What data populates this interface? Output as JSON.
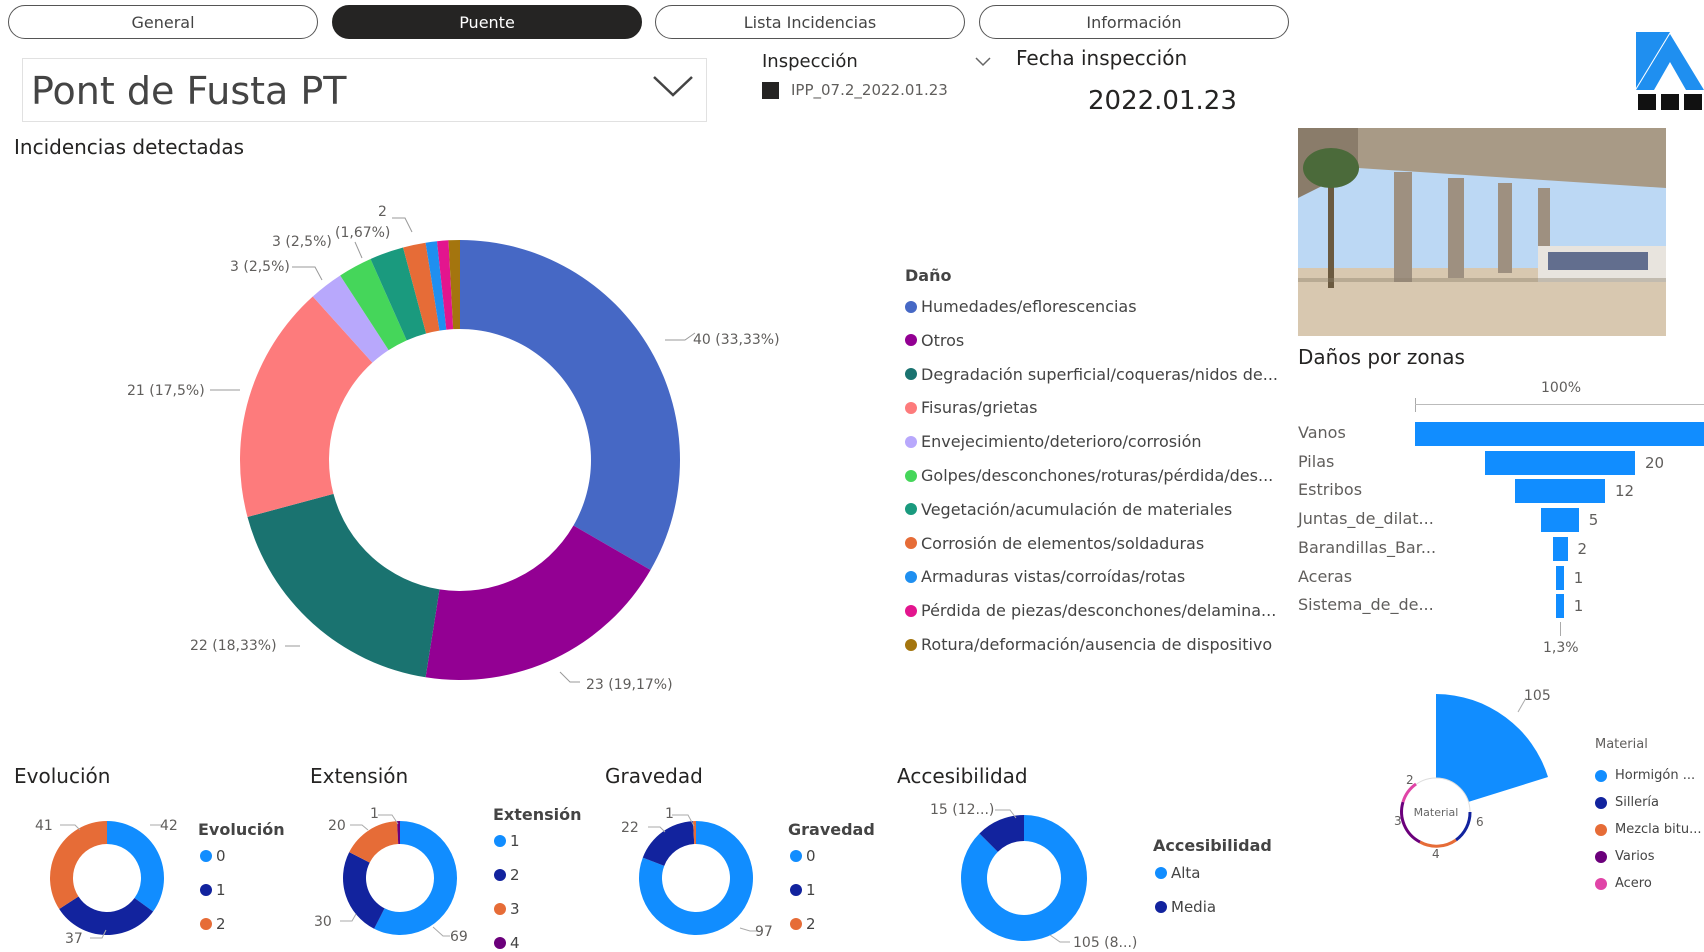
{
  "tabs": [
    {
      "label": "General",
      "active": false
    },
    {
      "label": "Puente",
      "active": true
    },
    {
      "label": "Lista Incidencias",
      "active": false
    },
    {
      "label": "Información",
      "active": false
    }
  ],
  "bridge_slicer": {
    "value": "Pont de Fusta PT"
  },
  "inspection": {
    "label": "Inspección",
    "item": "IPP_07.2_2022.01.23"
  },
  "date": {
    "label": "Fecha inspección",
    "value": "2022.01.23"
  },
  "main_chart_title": "Incidencias detectadas",
  "colors": {
    "humedades": "#4668c5",
    "otros": "#930093",
    "degradacion": "#1a7370",
    "fisuras": "#fd7b7c",
    "envejecimiento": "#b8a8fc",
    "golpes": "#45d65a",
    "vegetacion": "#1a9a7e",
    "corrosion": "#e66c37",
    "armaduras": "#1f8ff0",
    "perdida": "#e3158e",
    "rotura": "#a4750e",
    "blue": "#118dff",
    "navy": "#12239e",
    "orange": "#e66c37",
    "purple": "#6b007b",
    "pink": "#e044a7"
  },
  "chart_data": [
    {
      "type": "pie",
      "title": "Incidencias detectadas",
      "legend_title": "Daño",
      "legend_position": "right",
      "categories": [
        "Humedades/eflorescencias",
        "Otros",
        "Degradación superficial/coqueras/nidos de...",
        "Fisuras/grietas",
        "Envejecimiento/deterioro/corrosión",
        "Golpes/desconchones/roturas/pérdida/des...",
        "Vegetación/acumulación de materiales",
        "Corrosión de elementos/soldaduras",
        "Armaduras vistas/corroídas/rotas",
        "Pérdida de piezas/desconchones/delamina...",
        "Rotura/deformación/ausencia de dispositivo"
      ],
      "values": [
        40,
        23,
        22,
        21,
        3,
        3,
        3,
        2,
        1,
        1,
        1
      ],
      "data_labels": [
        "40 (33,33%)",
        "23 (19,17%)",
        "22 (18,33%)",
        "21 (17,5%)",
        "3 (2,5%)",
        "3 (2,5%)",
        "2",
        "(1,67%)"
      ]
    },
    {
      "type": "bar",
      "title": "Daños por zonas",
      "categories": [
        "Vanos",
        "Pilas",
        "Estribos",
        "Juntas_de_dilat...",
        "Barandillas_Bar...",
        "Aceras",
        "Sistema_de_de..."
      ],
      "values": [
        null,
        20,
        12,
        5,
        2,
        1,
        1
      ],
      "top_label": "100%",
      "bottom_label": "1,3%"
    },
    {
      "type": "pie",
      "title": "Material",
      "legend_title": "Material",
      "categories": [
        "Hormigón ...",
        "Sillería",
        "Mezcla bitu...",
        "Varios",
        "Acero"
      ],
      "values": [
        105,
        6,
        4,
        3,
        2
      ],
      "center_label": "Material"
    },
    {
      "type": "pie",
      "title": "Evolución",
      "legend_title": "Evolución",
      "categories": [
        "0",
        "1",
        "2"
      ],
      "values": [
        42,
        37,
        41
      ]
    },
    {
      "type": "pie",
      "title": "Extensión",
      "legend_title": "Extensión",
      "categories": [
        "1",
        "2",
        "3",
        "4"
      ],
      "values": [
        69,
        30,
        20,
        1
      ]
    },
    {
      "type": "pie",
      "title": "Gravedad",
      "legend_title": "Gravedad",
      "categories": [
        "0",
        "1",
        "2"
      ],
      "values": [
        97,
        22,
        1
      ]
    },
    {
      "type": "pie",
      "title": "Accesibilidad",
      "legend_title": "Accesibilidad",
      "categories": [
        "Alta",
        "Media"
      ],
      "values": [
        105,
        15
      ],
      "data_labels": [
        "105 (8...)",
        "15 (12...)"
      ]
    }
  ],
  "zones_title": "Daños por zonas",
  "small_titles": {
    "evolucion": "Evolución",
    "extension": "Extensión",
    "gravedad": "Gravedad",
    "accesibilidad": "Accesibilidad"
  }
}
